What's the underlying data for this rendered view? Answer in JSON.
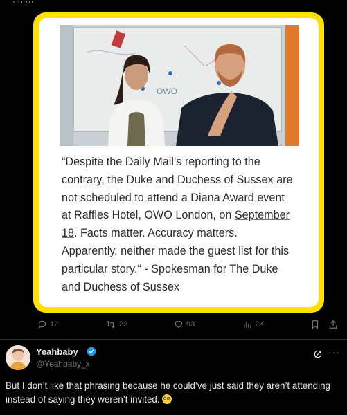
{
  "quoted_card": {
    "quote_lines": [
      "“Despite the Daily Mail’s reporting to the",
      "contrary, the Duke and Duchess of Sussex are",
      "not scheduled to attend a Diana Award event",
      "at Raffles Hotel, OWO London, on ",
      "September",
      "18",
      ". Facts matter. Accuracy matters.",
      "Apparently, neither made the guest list for this",
      "particular story.“ - Spokesman for The Duke",
      "and Duchess of Sussex"
    ],
    "frame_color": "#ffe000"
  },
  "tweet_actions": {
    "replies": "12",
    "reposts": "22",
    "likes": "93",
    "views": "2K"
  },
  "reply": {
    "name": "Yeahbaby",
    "handle": "@Yeahbaby_x",
    "text": "But I don’t like that phrasing because he could’ve just said they aren’t attending instead of saying they weren’t invited.",
    "more_label": "···"
  },
  "icons": {
    "reply": "reply-icon",
    "repost": "repost-icon",
    "like": "heart-icon",
    "views": "views-icon",
    "bookmark": "bookmark-icon",
    "share": "share-icon",
    "verified": "verified-badge-icon",
    "grok": "grok-icon",
    "emoji": "face-with-rolling-eyes-emoji"
  },
  "colors": {
    "background": "#000000",
    "text_primary": "#e7e9ea",
    "text_secondary": "#71767b",
    "verified_blue": "#1d9bf0"
  }
}
